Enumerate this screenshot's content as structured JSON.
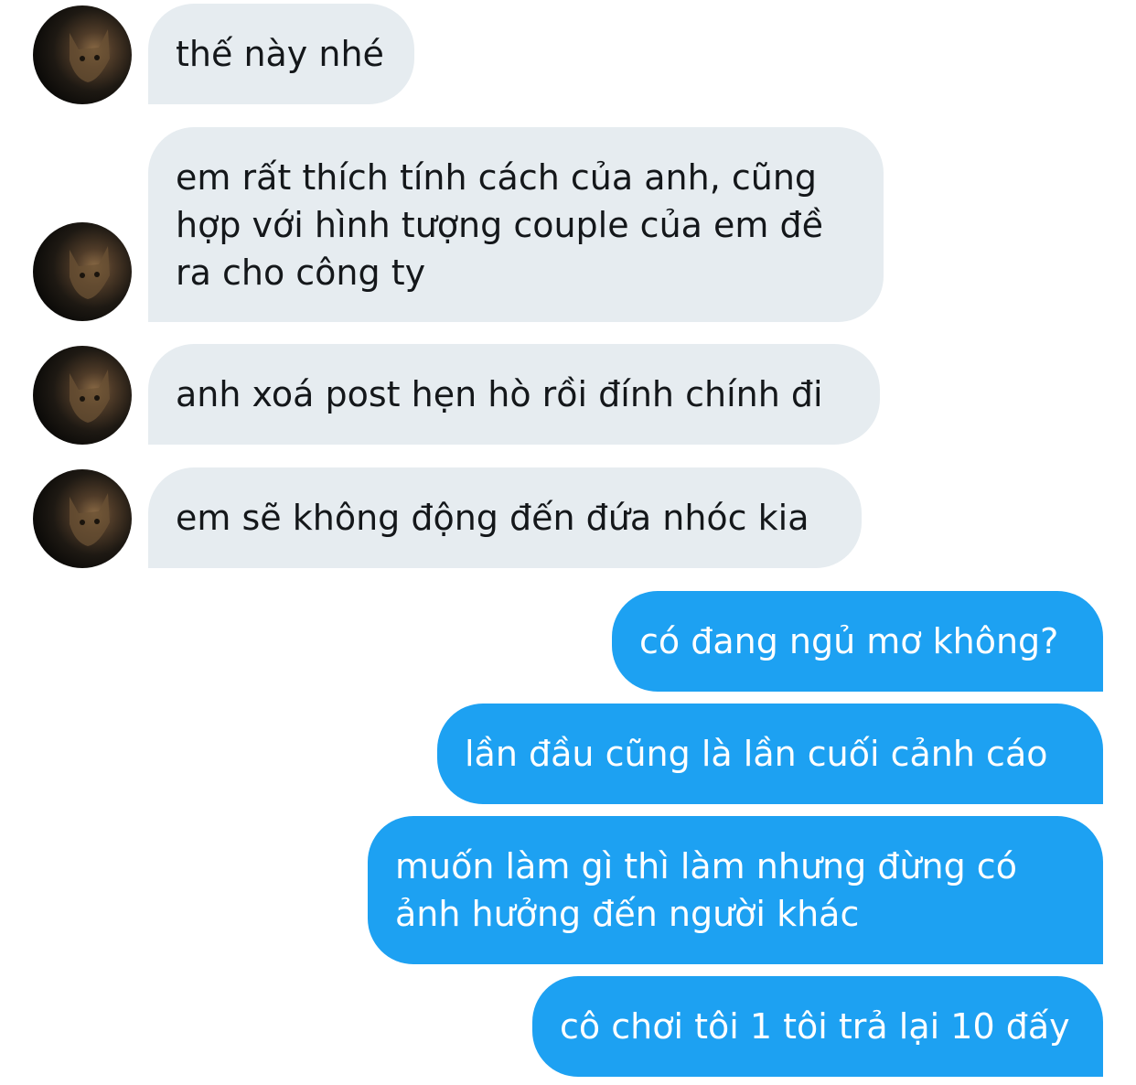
{
  "messages": [
    {
      "side": "received",
      "text": "thế này nhé",
      "avatar_icon": "cat-avatar-icon"
    },
    {
      "side": "received",
      "text": "em rất thích tính cách của anh, cũng\nhợp với hình tượng couple của em đề\nra cho công ty",
      "avatar_icon": "cat-avatar-icon"
    },
    {
      "side": "received",
      "text": "anh xoá post hẹn hò rồi đính chính đi",
      "avatar_icon": "cat-avatar-icon"
    },
    {
      "side": "received",
      "text": "em sẽ không động đến đứa nhóc kia",
      "avatar_icon": "cat-avatar-icon"
    },
    {
      "side": "sent",
      "text": "có đang ngủ mơ không?"
    },
    {
      "side": "sent",
      "text": "lần đầu cũng là lần cuối cảnh cáo"
    },
    {
      "side": "sent",
      "text": "muốn làm gì thì làm nhưng đừng có\nảnh hưởng đến người khác"
    },
    {
      "side": "sent",
      "text": "cô chơi tôi 1 tôi trả lại 10 đấy"
    }
  ],
  "colors": {
    "received_bubble": "#e6ecf0",
    "received_text": "#14171a",
    "sent_bubble": "#1da1f2",
    "sent_text": "#ffffff"
  }
}
